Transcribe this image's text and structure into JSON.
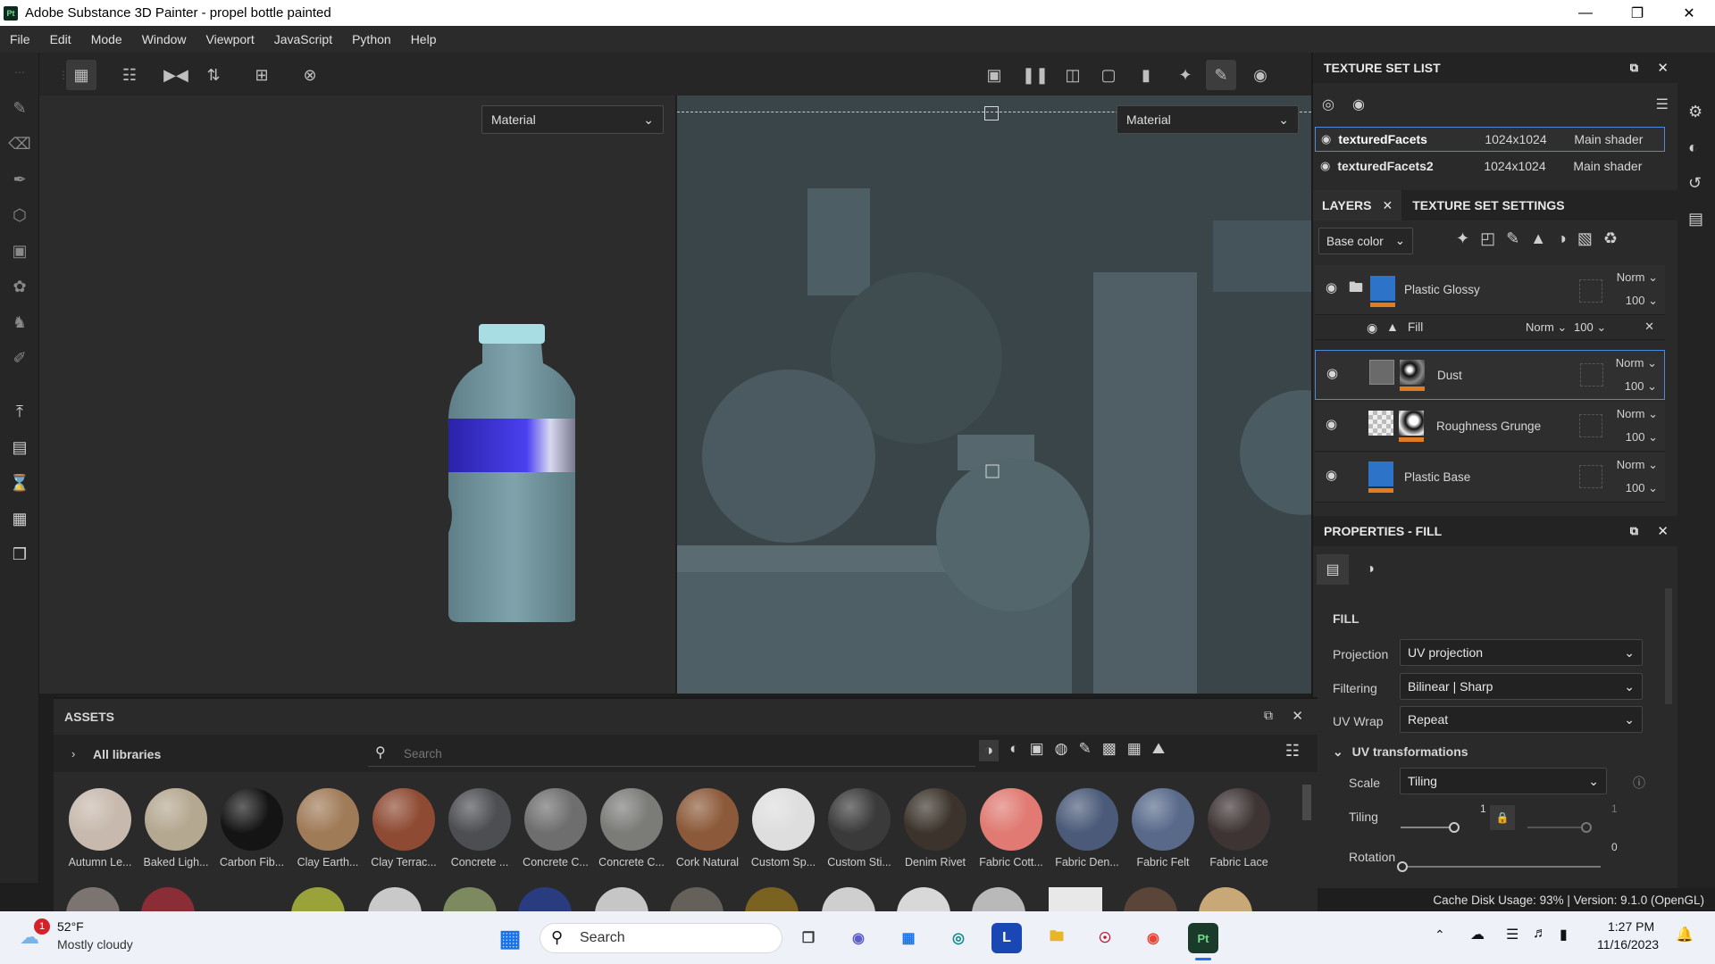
{
  "window": {
    "title": "Adobe Substance 3D Painter - propel bottle painted",
    "app_icon": "Pt"
  },
  "menu": [
    "File",
    "Edit",
    "Mode",
    "Window",
    "Viewport",
    "JavaScript",
    "Python",
    "Help"
  ],
  "viewport": {
    "left_mode": "Material",
    "right_mode": "Material"
  },
  "texture_set_list": {
    "title": "TEXTURE SET LIST",
    "rows": [
      {
        "name": "texturedFacets",
        "size": "1024x1024",
        "shader": "Main shader"
      },
      {
        "name": "texturedFacets2",
        "size": "1024x1024",
        "shader": "Main shader"
      }
    ]
  },
  "layers_panel": {
    "tab_layers": "LAYERS",
    "tab_settings": "TEXTURE SET SETTINGS",
    "channel": "Base color",
    "layers": [
      {
        "name": "Plastic Glossy",
        "blend": "Norm",
        "opacity": "100"
      },
      {
        "name": "Fill",
        "blend": "Norm",
        "opacity": "100"
      },
      {
        "name": "Dust",
        "blend": "Norm",
        "opacity": "100"
      },
      {
        "name": "Roughness Grunge",
        "blend": "Norm",
        "opacity": "100"
      },
      {
        "name": "Plastic Base",
        "blend": "Norm",
        "opacity": "100"
      }
    ]
  },
  "properties": {
    "title": "PROPERTIES - FILL",
    "section": "FILL",
    "projection_label": "Projection",
    "projection_value": "UV projection",
    "filtering_label": "Filtering",
    "filtering_value": "Bilinear | Sharp",
    "uvwrap_label": "UV Wrap",
    "uvwrap_value": "Repeat",
    "uvtrans_label": "UV transformations",
    "scale_label": "Scale",
    "scale_value": "Tiling",
    "tiling_label": "Tiling",
    "tiling_value": "1",
    "tiling_value2": "1",
    "rotation_label": "Rotation",
    "rotation_value": "0"
  },
  "assets": {
    "title": "ASSETS",
    "libraries": "All libraries",
    "search_placeholder": "Search",
    "materials": [
      {
        "label": "Autumn Le...",
        "color": "#c7b9ad"
      },
      {
        "label": "Baked Ligh...",
        "color": "#b5a891"
      },
      {
        "label": "Carbon Fib...",
        "color": "#141414"
      },
      {
        "label": "Clay Earth...",
        "color": "#a07b58"
      },
      {
        "label": "Clay Terrac...",
        "color": "#8e4a33"
      },
      {
        "label": "Concrete ...",
        "color": "#4d4e52"
      },
      {
        "label": "Concrete C...",
        "color": "#6e6e6e"
      },
      {
        "label": "Concrete C...",
        "color": "#7b7b78"
      },
      {
        "label": "Cork Natural",
        "color": "#8c5a3a"
      },
      {
        "label": "Custom Sp...",
        "color": "#dedede"
      },
      {
        "label": "Custom Sti...",
        "color": "#3a3a3a"
      },
      {
        "label": "Denim Rivet",
        "color": "#3c342c"
      },
      {
        "label": "Fabric Cott...",
        "color": "#e07a72"
      },
      {
        "label": "Fabric Den...",
        "color": "#4a5a78"
      },
      {
        "label": "Fabric Felt",
        "color": "#58698a"
      },
      {
        "label": "Fabric Lace",
        "color": "#3e3434"
      }
    ]
  },
  "status": {
    "text": "Cache Disk Usage:  93% | Version: 9.1.0 (OpenGL)"
  },
  "taskbar": {
    "weather_temp": "52°F",
    "weather_desc": "Mostly cloudy",
    "weather_badge": "1",
    "search": "Search",
    "time": "1:27 PM",
    "date": "11/16/2023"
  }
}
